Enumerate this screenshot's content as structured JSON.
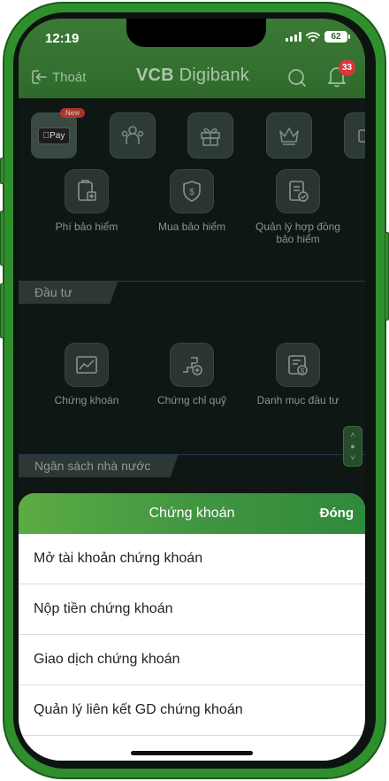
{
  "status": {
    "time": "12:19",
    "battery": "62"
  },
  "header": {
    "exit_label": "Thoát",
    "brand_bold": "VCB",
    "brand_rest": " Digibank",
    "notification_count": "33"
  },
  "top_row": {
    "new_badge": "New",
    "apple_pay_label": "Pay"
  },
  "insurance": {
    "items": [
      {
        "label": "Phí bảo hiểm",
        "icon": "insurance-fee-icon"
      },
      {
        "label": "Mua bảo hiểm",
        "icon": "shield-dollar-icon"
      },
      {
        "label": "Quản lý hợp đồng bảo hiểm",
        "icon": "contract-check-icon"
      }
    ]
  },
  "invest": {
    "section_title": "Đầu tư",
    "items": [
      {
        "label": "Chứng khoán",
        "icon": "stock-chart-icon"
      },
      {
        "label": "Chứng chỉ quỹ",
        "icon": "fund-growth-icon"
      },
      {
        "label": "Danh mục đầu tư",
        "icon": "portfolio-icon"
      }
    ]
  },
  "budget_section": {
    "title": "Ngân sách nhà nước"
  },
  "sheet": {
    "title": "Chứng khoán",
    "close_label": "Đóng",
    "items": [
      "Mở tài khoản chứng khoán",
      "Nộp tiền chứng khoán",
      "Giao dịch chứng khoán",
      "Quản lý liên kết GD chứng khoán"
    ]
  },
  "colors": {
    "accent": "#3f9440",
    "badge": "#d9363a",
    "frame": "#2f8f2c"
  }
}
